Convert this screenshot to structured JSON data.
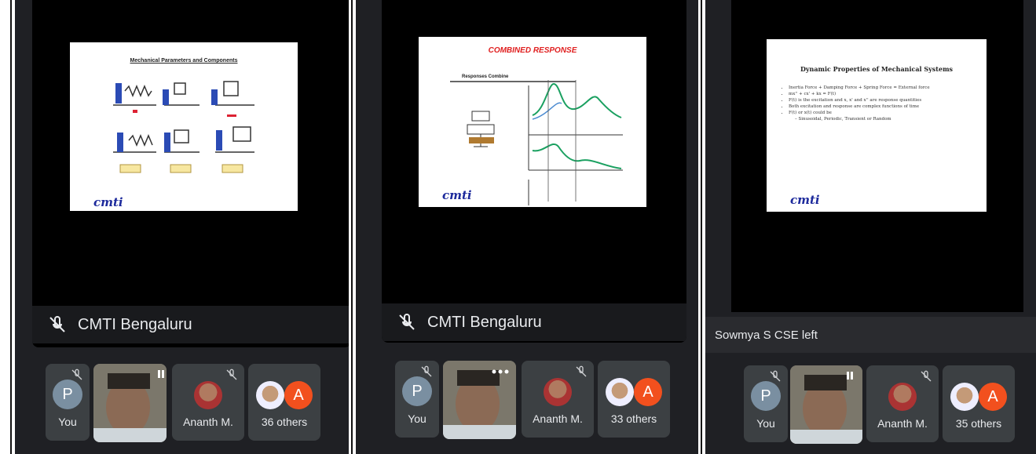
{
  "panels": [
    {
      "speaker": "CMTI Bengaluru",
      "slide_title": "Mechanical Parameters and Components",
      "slide_logo": "cmti",
      "participants": {
        "you": "You",
        "you_initial": "P",
        "other": "Ananth M.",
        "others": "36 others",
        "others_initial": "A"
      }
    },
    {
      "speaker": "CMTI Bengaluru",
      "slide_title": "COMBINED RESPONSE",
      "slide_subtitle": "Responses Combine",
      "slide_logo": "cmti",
      "participants": {
        "you": "You",
        "you_initial": "P",
        "other": "Ananth M.",
        "others": "33 others",
        "others_initial": "A"
      }
    },
    {
      "notice": "Sowmya S CSE left",
      "slide_title": "Dynamic Properties of Mechanical Systems",
      "slide_bullets": [
        "Inertia Force + Damping Force + Spring Force = External force",
        "mx'' + cx' + kx = F(t)",
        "F(t) is the excitation and x, x' and x'' are response quantities",
        "Both excitation and response are complex functions of time",
        "F(t) or x(t) could be",
        "– Sinusoidal, Periodic, Transient or Random"
      ],
      "slide_logo": "cmti",
      "participants": {
        "you": "You",
        "you_initial": "P",
        "other": "Ananth M.",
        "others": "35 others",
        "others_initial": "A"
      }
    }
  ],
  "colors": {
    "panel_bg": "#1f2024",
    "tile_bg": "#3c4043",
    "avatar_p": "#7a8fa1",
    "avatar_a": "#f2501e",
    "slide_title_red": "#e02020"
  },
  "icons": [
    "mic-off-icon",
    "more-icon"
  ]
}
